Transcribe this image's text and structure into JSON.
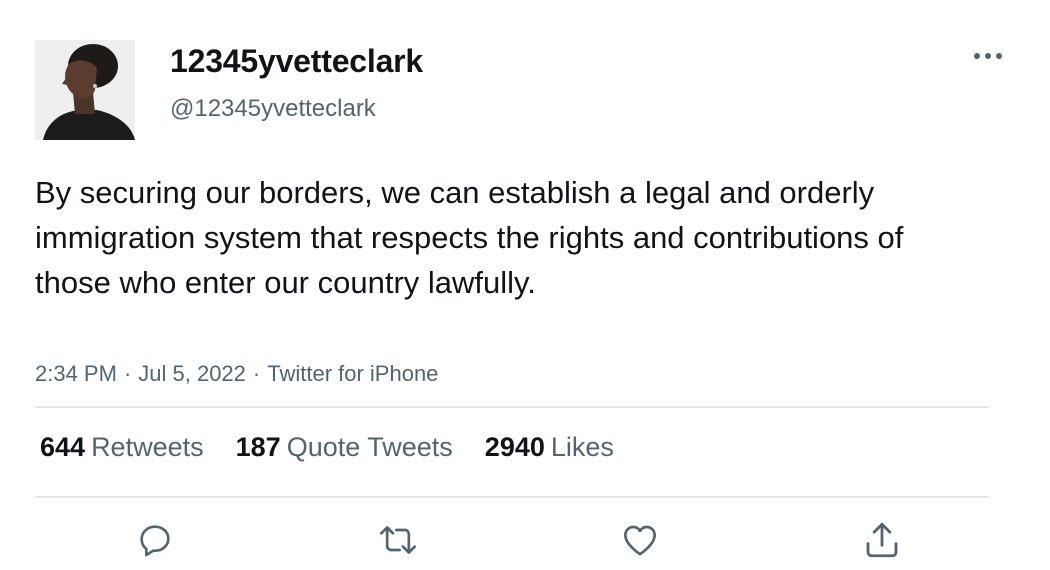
{
  "author": {
    "display_name": "12345yvetteclark",
    "handle": "@12345yvetteclark",
    "avatar_icon": "profile-photo-icon"
  },
  "tweet": {
    "text": "By securing our borders, we can establish a legal and orderly immigration system that respects the rights and contributions of those who enter our country lawfully.",
    "time": "2:34 PM",
    "date": "Jul 5, 2022",
    "source": "Twitter for iPhone",
    "separator": "·"
  },
  "stats": {
    "retweets_count": "644",
    "retweets_label": "Retweets",
    "quotes_count": "187",
    "quotes_label": "Quote Tweets",
    "likes_count": "2940",
    "likes_label": "Likes"
  },
  "actions": {
    "reply_icon": "reply-icon",
    "retweet_icon": "retweet-icon",
    "like_icon": "heart-icon",
    "share_icon": "share-icon",
    "more_icon": "more-icon"
  },
  "colors": {
    "text_primary": "#0f1419",
    "text_secondary": "#536471",
    "icon": "#536471",
    "divider": "#e4e6e8"
  }
}
